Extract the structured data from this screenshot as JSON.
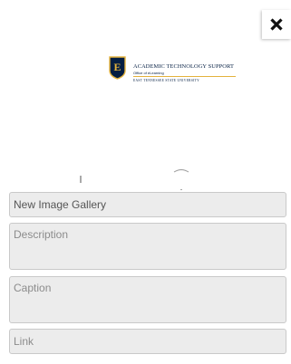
{
  "close_button": {
    "icon": "close-icon",
    "color": "#111111"
  },
  "logo": {
    "icon": "etsu-shield-icon",
    "initial": "E",
    "title": "ACADEMIC TECHNOLOGY SUPPORT",
    "subtitle": "Office of eLearning",
    "university": "EAST TENNESSEE STATE UNIVERSITY",
    "colors": {
      "navy": "#041e42",
      "gold": "#e3b23c"
    }
  },
  "form": {
    "title_field": {
      "placeholder": "",
      "value": "New Image Gallery"
    },
    "description_field": {
      "placeholder": "Description",
      "value": ""
    },
    "caption_field": {
      "placeholder": "Caption",
      "value": ""
    },
    "link_field": {
      "placeholder": "Link",
      "value": ""
    }
  }
}
